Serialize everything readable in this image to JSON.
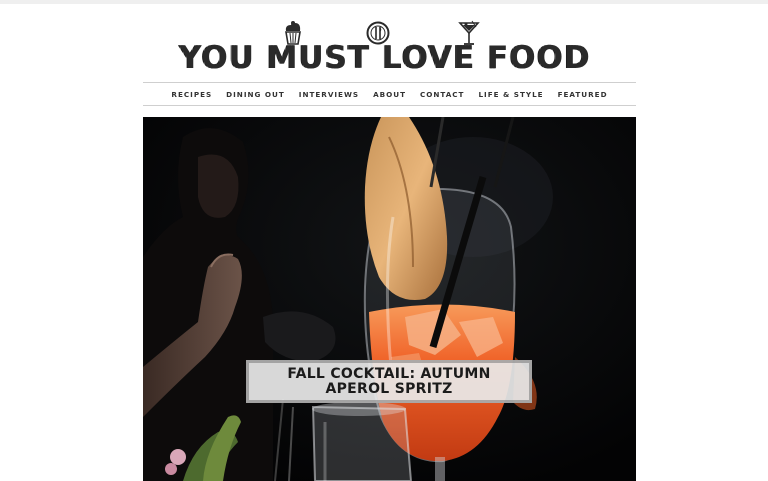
{
  "site": {
    "title": "YOU MUST LOVE FOOD",
    "logo_icons": [
      "cupcake-icon",
      "fork-knife-badge-icon",
      "cocktail-glass-icon"
    ]
  },
  "nav": {
    "items": [
      {
        "label": "RECIPES"
      },
      {
        "label": "DINING OUT"
      },
      {
        "label": "INTERVIEWS"
      },
      {
        "label": "ABOUT"
      },
      {
        "label": "CONTACT"
      },
      {
        "label": "LIFE & STYLE"
      },
      {
        "label": "FEATURED"
      }
    ]
  },
  "featured_post": {
    "title": "FALL COCKTAIL: AUTUMN APEROL SPRITZ"
  },
  "colors": {
    "logo_text": "#2a2a2a",
    "nav_text": "#333333",
    "nav_border": "#cfcfcf",
    "hero_background": "#050607",
    "drink_orange": "#f0642a",
    "caption_background": "#e8e8e8"
  }
}
